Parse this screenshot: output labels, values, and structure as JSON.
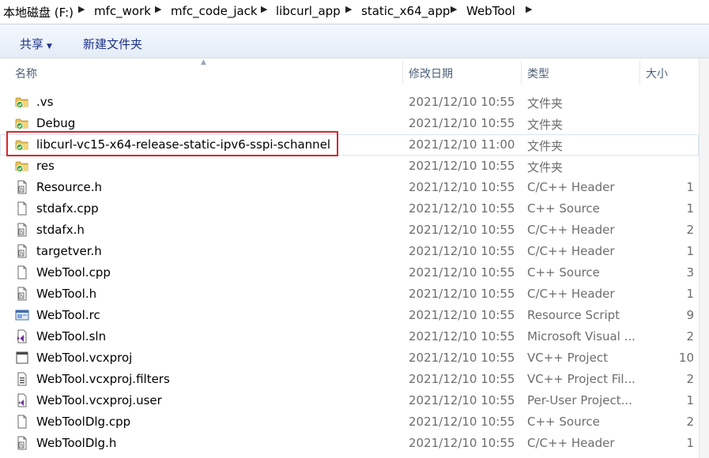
{
  "breadcrumb": [
    "本地磁盘 (F:)",
    "mfc_work",
    "mfc_code_jack",
    "libcurl_app",
    "static_x64_app",
    "WebTool"
  ],
  "toolbar": {
    "share_label": "共享",
    "new_folder_label": "新建文件夹"
  },
  "columns": {
    "name": "名称",
    "modified": "修改日期",
    "type": "类型",
    "size": "大小"
  },
  "files": [
    {
      "name": ".vs",
      "date": "2021/12/10 10:55",
      "type": "文件夹",
      "size": "",
      "icon": "folder-icon"
    },
    {
      "name": "Debug",
      "date": "2021/12/10 10:55",
      "type": "文件夹",
      "size": "",
      "icon": "folder-icon"
    },
    {
      "name": "libcurl-vc15-x64-release-static-ipv6-sspi-schannel",
      "date": "2021/12/10 11:00",
      "type": "文件夹",
      "size": "",
      "icon": "folder-icon"
    },
    {
      "name": "res",
      "date": "2021/12/10 10:55",
      "type": "文件夹",
      "size": "",
      "icon": "folder-icon"
    },
    {
      "name": "Resource.h",
      "date": "2021/12/10 10:55",
      "type": "C/C++ Header",
      "size": "1",
      "icon": "header-file-icon"
    },
    {
      "name": "stdafx.cpp",
      "date": "2021/12/10 10:55",
      "type": "C++ Source",
      "size": "1",
      "icon": "source-file-icon"
    },
    {
      "name": "stdafx.h",
      "date": "2021/12/10 10:55",
      "type": "C/C++ Header",
      "size": "2",
      "icon": "header-file-icon"
    },
    {
      "name": "targetver.h",
      "date": "2021/12/10 10:55",
      "type": "C/C++ Header",
      "size": "1",
      "icon": "header-file-icon"
    },
    {
      "name": "WebTool.cpp",
      "date": "2021/12/10 10:55",
      "type": "C++ Source",
      "size": "3",
      "icon": "source-file-icon"
    },
    {
      "name": "WebTool.h",
      "date": "2021/12/10 10:55",
      "type": "C/C++ Header",
      "size": "1",
      "icon": "header-file-icon"
    },
    {
      "name": "WebTool.rc",
      "date": "2021/12/10 10:55",
      "type": "Resource Script",
      "size": "9",
      "icon": "resource-script-icon"
    },
    {
      "name": "WebTool.sln",
      "date": "2021/12/10 10:55",
      "type": "Microsoft Visual ...",
      "size": "2",
      "icon": "visual-studio-solution-icon"
    },
    {
      "name": "WebTool.vcxproj",
      "date": "2021/12/10 10:55",
      "type": "VC++ Project",
      "size": "10",
      "icon": "project-file-icon"
    },
    {
      "name": "WebTool.vcxproj.filters",
      "date": "2021/12/10 10:55",
      "type": "VC++ Project Fil...",
      "size": "2",
      "icon": "filters-file-icon"
    },
    {
      "name": "WebTool.vcxproj.user",
      "date": "2021/12/10 10:55",
      "type": "Per-User Project...",
      "size": "1",
      "icon": "user-project-file-icon"
    },
    {
      "name": "WebToolDlg.cpp",
      "date": "2021/12/10 10:55",
      "type": "C++ Source",
      "size": "2",
      "icon": "source-file-icon"
    },
    {
      "name": "WebToolDlg.h",
      "date": "2021/12/10 10:55",
      "type": "C/C++ Header",
      "size": "1",
      "icon": "header-file-icon"
    }
  ],
  "colors": {
    "highlight": "#d9272e",
    "toolbar_text": "#1e3287",
    "header_text": "#4c607a",
    "muted_text": "#6d6d6d"
  }
}
